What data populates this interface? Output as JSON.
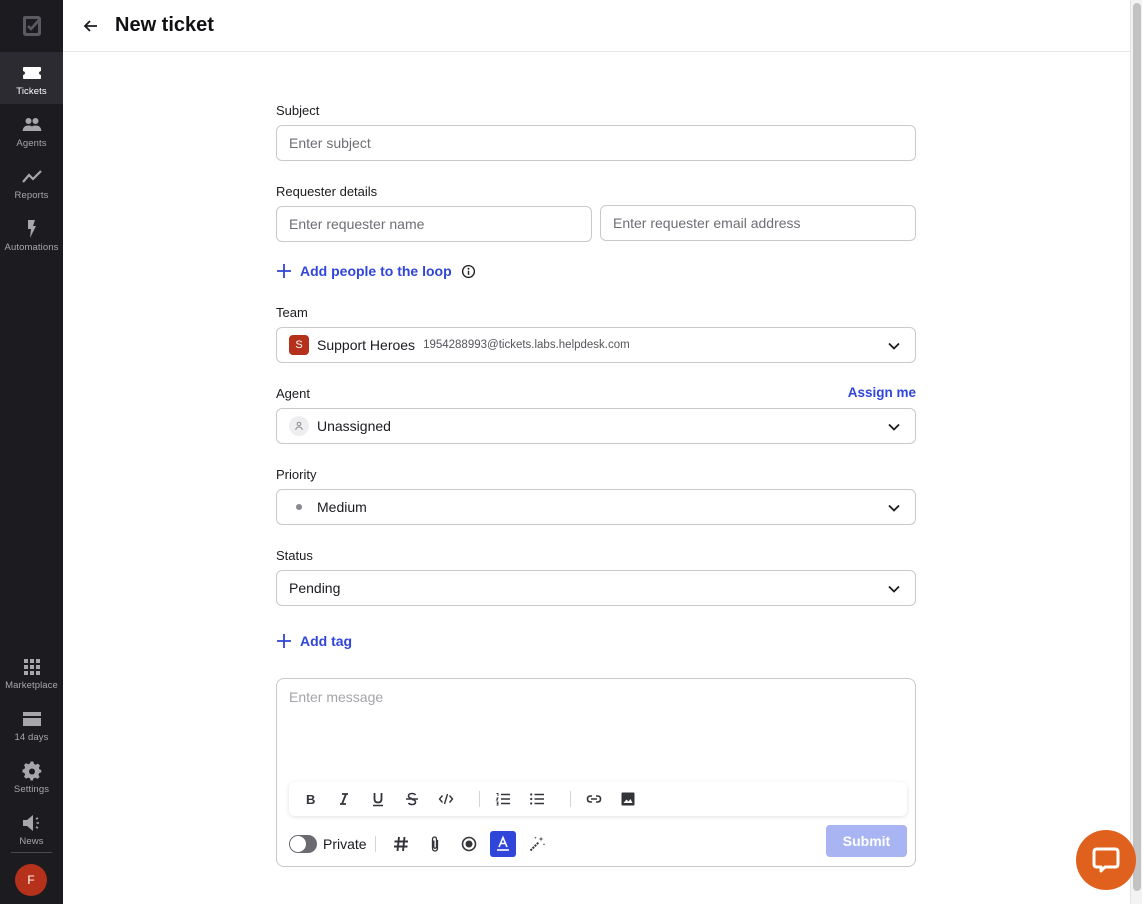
{
  "sidebar": {
    "logo": "helpdesk-logo",
    "items": [
      {
        "label": "Tickets",
        "icon": "ticket-icon",
        "active": true
      },
      {
        "label": "Agents",
        "icon": "agents-icon",
        "active": false
      },
      {
        "label": "Reports",
        "icon": "reports-icon",
        "active": false
      },
      {
        "label": "Automations",
        "icon": "lightning-icon",
        "active": false
      }
    ],
    "bottom_items": [
      {
        "label": "Marketplace",
        "icon": "grid-icon"
      },
      {
        "label": "14 days",
        "icon": "card-icon"
      },
      {
        "label": "Settings",
        "icon": "gear-icon"
      },
      {
        "label": "News",
        "icon": "megaphone-icon"
      }
    ],
    "avatar_initial": "F"
  },
  "header": {
    "title": "New ticket",
    "back_icon": "arrow-left-icon"
  },
  "form": {
    "subject": {
      "label": "Subject",
      "value": "",
      "placeholder": "Enter subject"
    },
    "requester": {
      "label": "Requester details",
      "name": {
        "value": "",
        "placeholder": "Enter requester name"
      },
      "email": {
        "value": "",
        "placeholder": "Enter requester email address"
      }
    },
    "add_people_label": "Add people to the loop",
    "team": {
      "label": "Team",
      "initial": "S",
      "name": "Support Heroes",
      "email": "1954288993@tickets.labs.helpdesk.com"
    },
    "agent": {
      "label": "Agent",
      "assign_me_label": "Assign me",
      "value": "Unassigned"
    },
    "priority": {
      "label": "Priority",
      "value": "Medium"
    },
    "status": {
      "label": "Status",
      "value": "Pending"
    },
    "add_tag_label": "Add tag",
    "message": {
      "value": "",
      "placeholder": "Enter message",
      "format_tools": [
        "bold",
        "italic",
        "underline",
        "strikethrough",
        "code",
        "ordered-list",
        "bullet-list",
        "link",
        "image"
      ],
      "private_label": "Private",
      "private_enabled": false,
      "bottom_tools": [
        "hashtag",
        "attachment",
        "record",
        "text-format",
        "ai-magic"
      ],
      "active_tool": "text-format",
      "submit_label": "Submit"
    }
  },
  "colors": {
    "accent": "#3045d9",
    "sidebar_bg": "#1b1b20",
    "team_badge": "#b5311b",
    "chat_bubble": "#e0601e",
    "submit_disabled": "#a8b5f2"
  }
}
